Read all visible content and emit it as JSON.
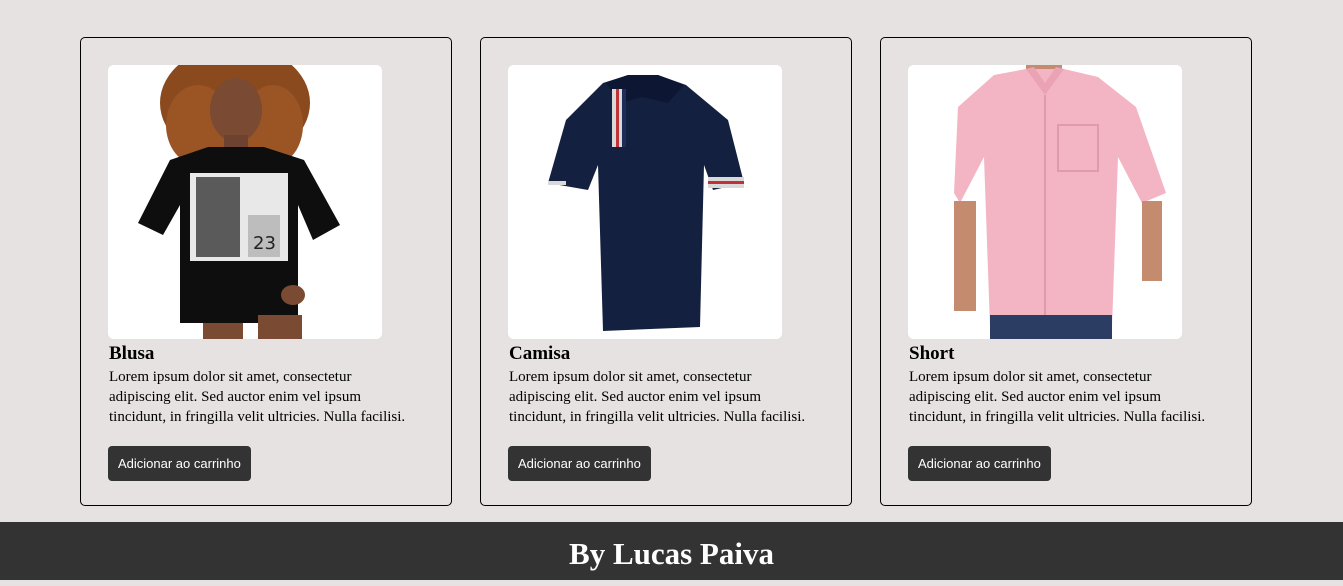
{
  "products": [
    {
      "image": "woman-black-tshirt-photo",
      "title": "Blusa",
      "description": "Lorem ipsum dolor sit amet, consectetur adipiscing elit. Sed auctor enim vel ipsum tincidunt, in fringilla velit ultricies. Nulla facilisi.",
      "button_label": "Adicionar ao carrinho"
    },
    {
      "image": "navy-polo-shirt-photo",
      "title": "Camisa",
      "description": "Lorem ipsum dolor sit amet, consectetur adipiscing elit. Sed auctor enim vel ipsum tincidunt, in fringilla velit ultricies. Nulla facilisi.",
      "button_label": "Adicionar ao carrinho"
    },
    {
      "image": "man-pink-shirt-photo",
      "title": "Short",
      "description": "Lorem ipsum dolor sit amet, consectetur adipiscing elit. Sed auctor enim vel ipsum tincidunt, in fringilla velit ultricies. Nulla facilisi.",
      "button_label": "Adicionar ao carrinho"
    }
  ],
  "footer": {
    "text": "By Lucas Paiva"
  },
  "colors": {
    "page_background": "#e6e2e1",
    "button_background": "#333333",
    "footer_background": "#333333",
    "card_border": "#000000"
  }
}
